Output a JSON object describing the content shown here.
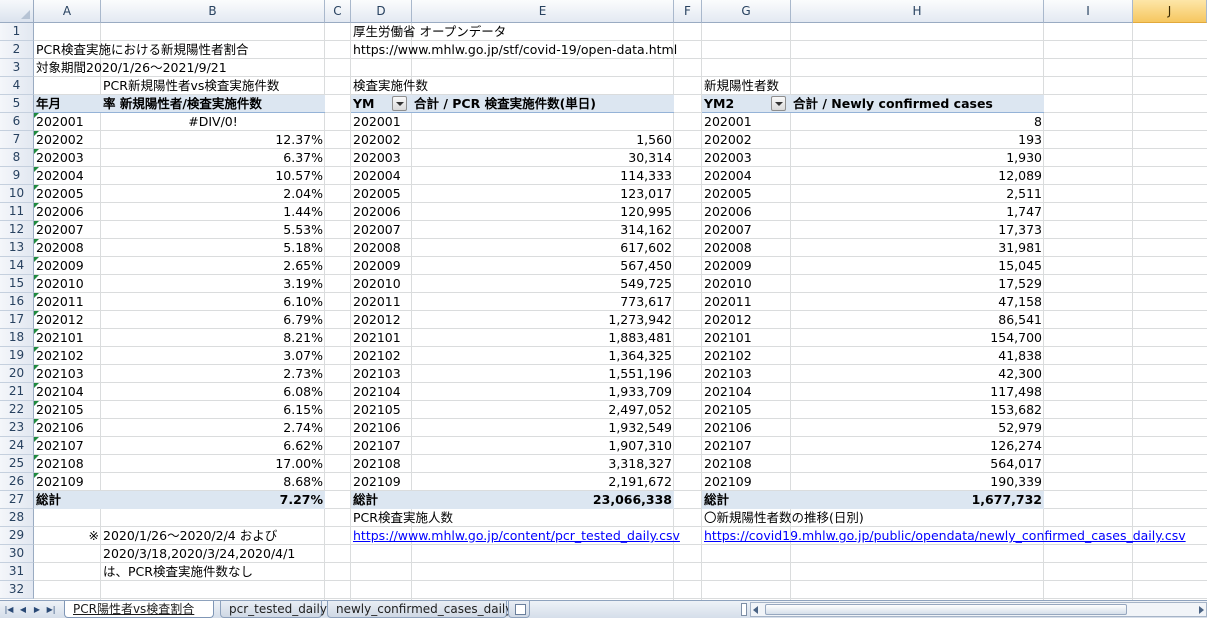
{
  "columns": [
    "A",
    "B",
    "C",
    "D",
    "E",
    "F",
    "G",
    "H",
    "I",
    "J"
  ],
  "selected_column": "J",
  "rows": [
    "1",
    "2",
    "3",
    "4",
    "5",
    "6",
    "7",
    "8",
    "9",
    "10",
    "11",
    "12",
    "13",
    "14",
    "15",
    "16",
    "17",
    "18",
    "19",
    "20",
    "21",
    "22",
    "23",
    "24",
    "25",
    "26",
    "27",
    "28",
    "29",
    "30",
    "31",
    "32"
  ],
  "header_block": {
    "a2": "PCR検査実施における新規陽性者割合",
    "a3": "対象期間2020/1/26～2021/9/21",
    "b4": "PCR新規陽性者vs検査実施件数",
    "a5": "年月",
    "b5": "率  新規陽性者/検査実施件数",
    "d1": "厚生労働省 オープンデータ",
    "d2": "https://www.mhlw.go.jp/stf/covid-19/open-data.html",
    "d4": "検査実施件数",
    "d5": "YM",
    "e5": "合計 / PCR 検査実施件数(単日)",
    "g4": "新規陽性者数",
    "g5": "YM2",
    "h5": "合計 / Newly confirmed cases"
  },
  "table_rows": [
    {
      "ym": "202001",
      "rate": "#DIV/0!",
      "tests": "",
      "cases": "8"
    },
    {
      "ym": "202002",
      "rate": "12.37%",
      "tests": "1,560",
      "cases": "193"
    },
    {
      "ym": "202003",
      "rate": "6.37%",
      "tests": "30,314",
      "cases": "1,930"
    },
    {
      "ym": "202004",
      "rate": "10.57%",
      "tests": "114,333",
      "cases": "12,089"
    },
    {
      "ym": "202005",
      "rate": "2.04%",
      "tests": "123,017",
      "cases": "2,511"
    },
    {
      "ym": "202006",
      "rate": "1.44%",
      "tests": "120,995",
      "cases": "1,747"
    },
    {
      "ym": "202007",
      "rate": "5.53%",
      "tests": "314,162",
      "cases": "17,373"
    },
    {
      "ym": "202008",
      "rate": "5.18%",
      "tests": "617,602",
      "cases": "31,981"
    },
    {
      "ym": "202009",
      "rate": "2.65%",
      "tests": "567,450",
      "cases": "15,045"
    },
    {
      "ym": "202010",
      "rate": "3.19%",
      "tests": "549,725",
      "cases": "17,529"
    },
    {
      "ym": "202011",
      "rate": "6.10%",
      "tests": "773,617",
      "cases": "47,158"
    },
    {
      "ym": "202012",
      "rate": "6.79%",
      "tests": "1,273,942",
      "cases": "86,541"
    },
    {
      "ym": "202101",
      "rate": "8.21%",
      "tests": "1,883,481",
      "cases": "154,700"
    },
    {
      "ym": "202102",
      "rate": "3.07%",
      "tests": "1,364,325",
      "cases": "41,838"
    },
    {
      "ym": "202103",
      "rate": "2.73%",
      "tests": "1,551,196",
      "cases": "42,300"
    },
    {
      "ym": "202104",
      "rate": "6.08%",
      "tests": "1,933,709",
      "cases": "117,498"
    },
    {
      "ym": "202105",
      "rate": "6.15%",
      "tests": "2,497,052",
      "cases": "153,682"
    },
    {
      "ym": "202106",
      "rate": "2.74%",
      "tests": "1,932,549",
      "cases": "52,979"
    },
    {
      "ym": "202107",
      "rate": "6.62%",
      "tests": "1,907,310",
      "cases": "126,274"
    },
    {
      "ym": "202108",
      "rate": "17.00%",
      "tests": "3,318,327",
      "cases": "564,017"
    },
    {
      "ym": "202109",
      "rate": "8.68%",
      "tests": "2,191,672",
      "cases": "190,339"
    }
  ],
  "totals": {
    "label": "総計",
    "rate": "7.27%",
    "tests": "23,066,338",
    "cases": "1,677,732"
  },
  "footer_block": {
    "d28": "PCR検査実施人数",
    "d29": "https://www.mhlw.go.jp/content/pcr_tested_daily.csv",
    "g28": "〇新規陽性者数の推移(日別)",
    "g29": "https://covid19.mhlw.go.jp/public/opendata/newly_confirmed_cases_daily.csv",
    "a29": "※",
    "b29": "2020/1/26～2020/2/4 および",
    "b30": "2020/3/18,2020/3/24,2020/4/1",
    "b31": "は、PCR検査実施件数なし"
  },
  "tabs": [
    {
      "label": "PCR陽性者vs検査割合",
      "active": true
    },
    {
      "label": "pcr_tested_daily",
      "active": false
    },
    {
      "label": "newly_confirmed_cases_daily",
      "active": false
    }
  ],
  "colors": {
    "header_fill": "#dce6f1",
    "link": "#0000ff",
    "selected_column": "#f6c760"
  }
}
